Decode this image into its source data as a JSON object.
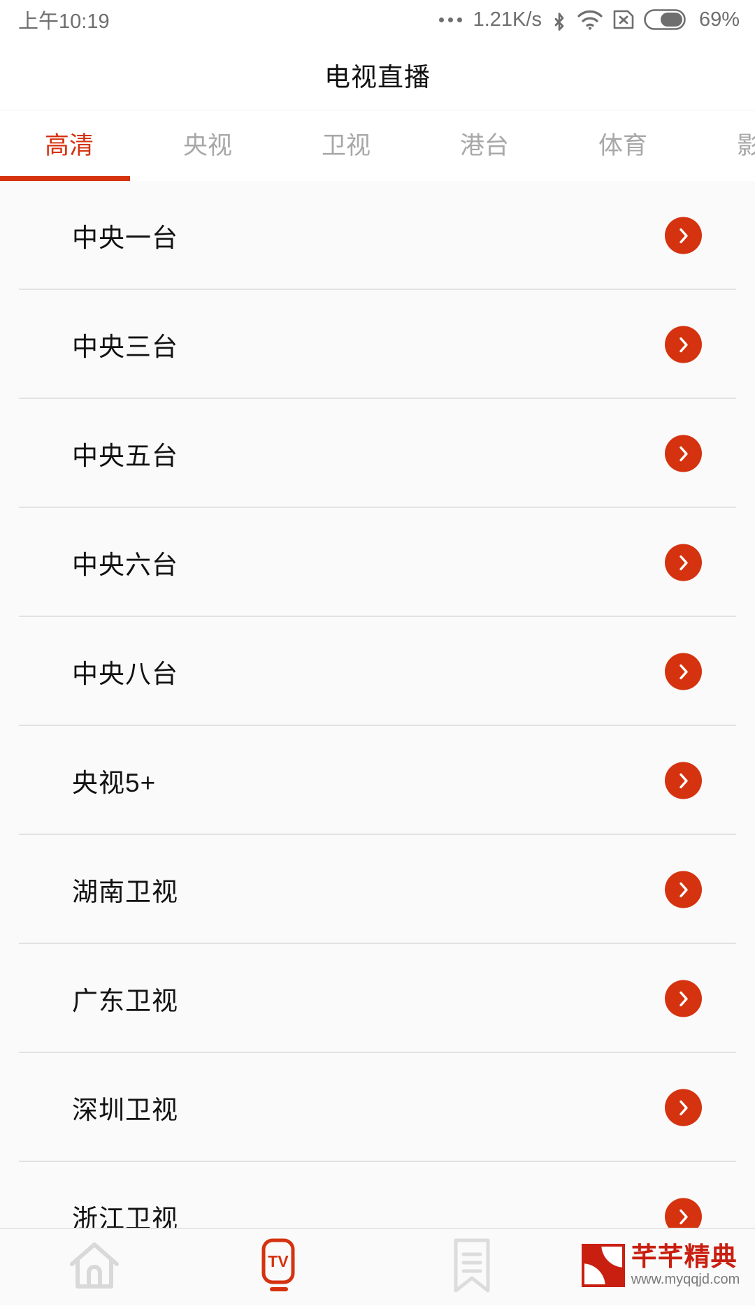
{
  "statusbar": {
    "time": "上午10:19",
    "network_speed": "1.21K/s",
    "battery_percent": "69%",
    "icons": [
      "ellipsis-icon",
      "bluetooth-icon",
      "wifi-icon",
      "sim-card-disabled-icon",
      "battery-icon"
    ]
  },
  "header": {
    "title": "电视直播"
  },
  "tabs": [
    {
      "label": "高清",
      "active": true
    },
    {
      "label": "央视",
      "active": false
    },
    {
      "label": "卫视",
      "active": false
    },
    {
      "label": "港台",
      "active": false
    },
    {
      "label": "体育",
      "active": false
    },
    {
      "label": "影视",
      "active": false
    }
  ],
  "channels": [
    {
      "name": "中央一台"
    },
    {
      "name": "中央三台"
    },
    {
      "name": "中央五台"
    },
    {
      "name": "中央六台"
    },
    {
      "name": "中央八台"
    },
    {
      "name": "央视5+"
    },
    {
      "name": "湖南卫视"
    },
    {
      "name": "广东卫视"
    },
    {
      "name": "深圳卫视"
    },
    {
      "name": "浙江卫视"
    }
  ],
  "bottom_nav": [
    {
      "icon": "home-icon",
      "active": false
    },
    {
      "icon": "tv-icon",
      "active": true
    },
    {
      "icon": "bookmark-icon",
      "active": false
    }
  ],
  "watermark": {
    "name": "芊芊精典",
    "url": "www.myqqjd.com"
  },
  "colors": {
    "accent": "#D5320F",
    "watermark": "#C81F10",
    "list_bg": "#FAFAFA",
    "text": "#121212",
    "muted": "#a8a8a8"
  }
}
